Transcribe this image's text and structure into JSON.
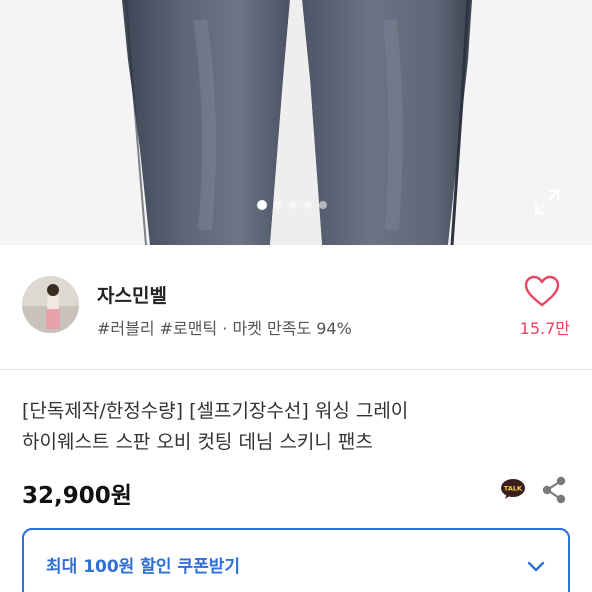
{
  "product_image": {
    "slide_count": 5,
    "active_slide": 1
  },
  "seller": {
    "name": "자스민벨",
    "tags": "#러블리 #로맨틱 · 마켓 만족도 94%",
    "like_count": "15.7만"
  },
  "product": {
    "title_line1": "[단독제작/한정수량] [셀프기장수선] 워싱 그레이",
    "title_line2": "하이웨스트 스판 오비 컷팅 데님 스키니 팬츠",
    "price": "32,900원",
    "talk_label": "TALK"
  },
  "coupon": {
    "label": "최대 100원 할인 쿠폰받기"
  },
  "colors": {
    "accent_blue": "#2f6fd8",
    "like_red": "#e8455f",
    "kakao_brown": "#3b1e1e"
  },
  "icons": {
    "expand": "expand-icon",
    "heart": "heart-icon",
    "talk": "kakao-talk-icon",
    "share": "share-icon",
    "chevron": "chevron-down-icon"
  }
}
